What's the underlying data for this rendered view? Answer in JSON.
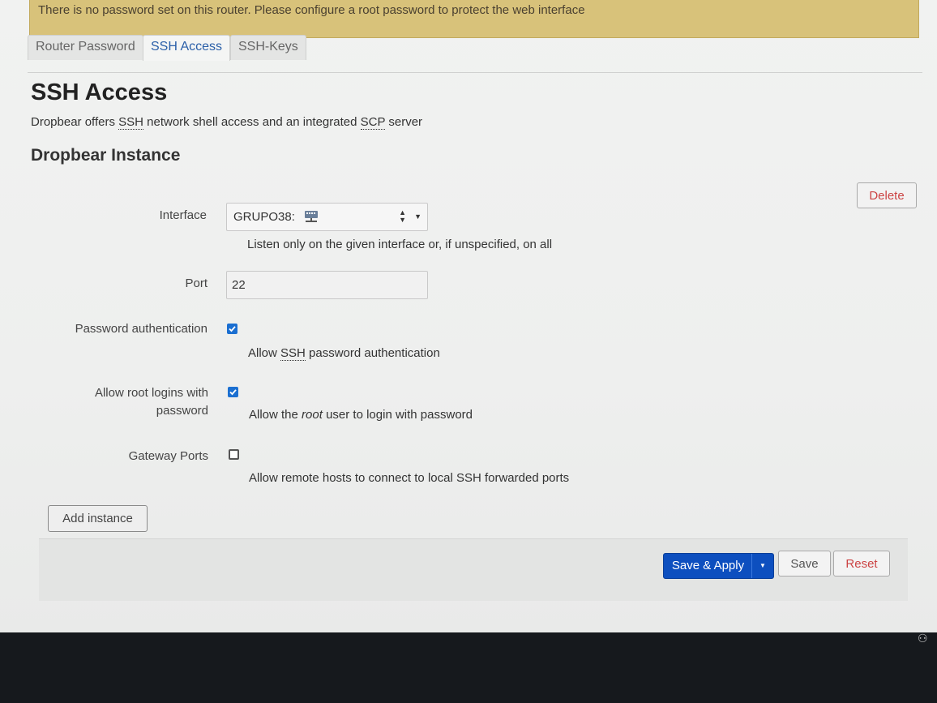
{
  "alert": {
    "text": "There is no password set on this router. Please configure a root password to protect the web interface"
  },
  "tabs": [
    {
      "label": "Router Password",
      "active": false
    },
    {
      "label": "SSH Access",
      "active": true
    },
    {
      "label": "SSH-Keys",
      "active": false
    }
  ],
  "page": {
    "title": "SSH Access",
    "description_prefix": "Dropbear offers ",
    "description_ssh": "SSH",
    "description_middle": " network shell access and an integrated ",
    "description_scp": "SCP",
    "description_suffix": " server"
  },
  "section": {
    "title": "Dropbear Instance",
    "delete_label": "Delete"
  },
  "fields": {
    "interface": {
      "label": "Interface",
      "value": "GRUPO38:",
      "icon": "network-icon",
      "description": "Listen only on the given interface or, if unspecified, on all"
    },
    "port": {
      "label": "Port",
      "value": "22"
    },
    "password_auth": {
      "label": "Password authentication",
      "checked": true,
      "desc_prefix": "Allow ",
      "desc_ssh": "SSH",
      "desc_suffix": " password authentication"
    },
    "root_login": {
      "label_line1": "Allow root logins with",
      "label_line2": "password",
      "checked": true,
      "desc_prefix": "Allow the ",
      "desc_root": "root",
      "desc_suffix": " user to login with password"
    },
    "gateway_ports": {
      "label": "Gateway Ports",
      "checked": false,
      "description": "Allow remote hosts to connect to local SSH forwarded ports"
    }
  },
  "actions": {
    "add_instance_label": "Add instance",
    "save_apply_label": "Save & Apply",
    "save_label": "Save",
    "reset_label": "Reset"
  },
  "colors": {
    "alert_bg": "#d8c27a",
    "primary": "#0d4fbf",
    "checkbox_checked": "#1a6fd1",
    "delete_text": "#c44",
    "reset_text": "#c44"
  }
}
